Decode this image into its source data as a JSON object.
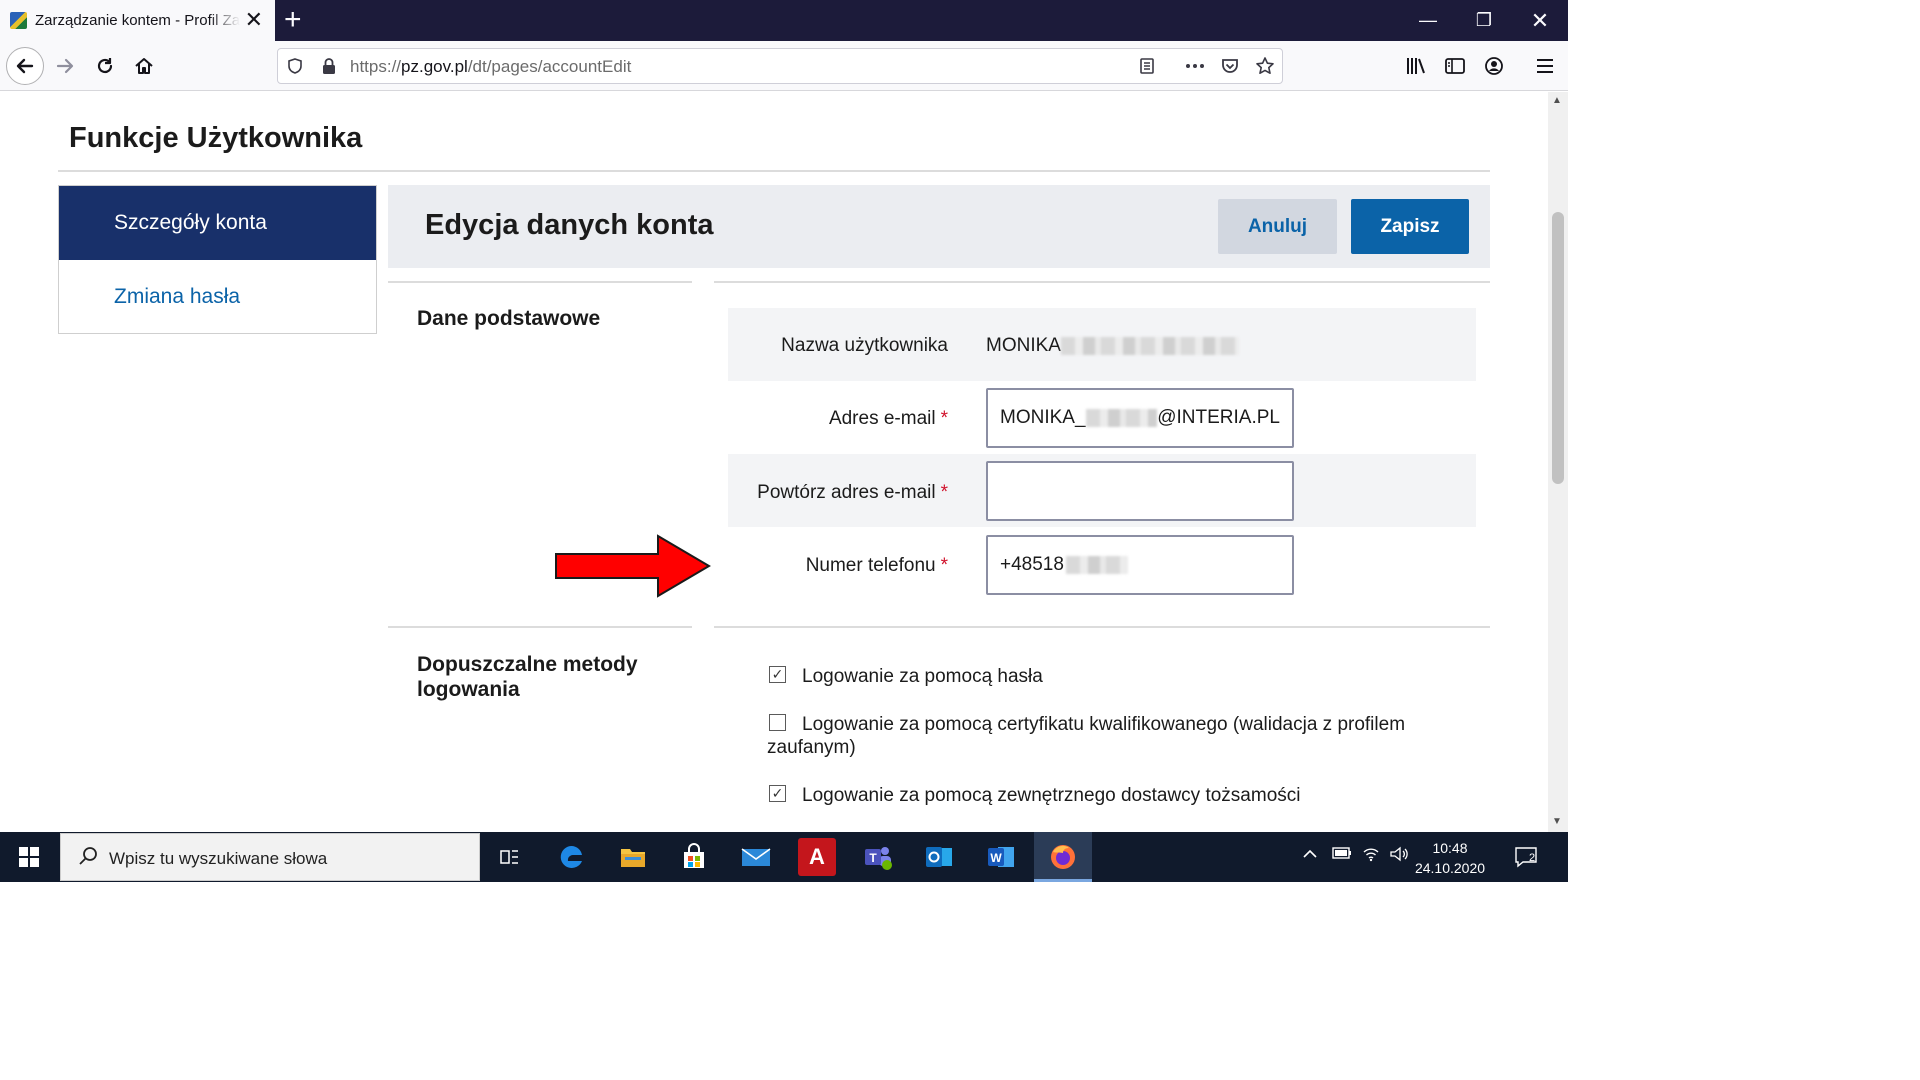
{
  "browser": {
    "tab_title": "Zarządzanie kontem - Profil Zaufany",
    "tab_close": "✕",
    "new_tab": "+",
    "url_prefix": "https://",
    "url_host": "pz.gov.pl",
    "url_path": "/dt/pages/accountEdit",
    "window_controls": {
      "minimize": "—",
      "restore": "❐",
      "close": "✕"
    },
    "icons": [
      "back-icon",
      "forward-icon",
      "reload-icon",
      "home-icon",
      "shield-icon",
      "lock-icon",
      "reader-view-icon",
      "more-icon",
      "pocket-icon",
      "bookmark-star-icon",
      "library-icon",
      "sidebar-icon",
      "account-icon",
      "menu-icon"
    ]
  },
  "page": {
    "section_title": "Funkcje Użytkownika",
    "sidebar": {
      "items": [
        {
          "label": "Szczegóły konta",
          "active": true
        },
        {
          "label": "Zmiana hasła",
          "active": false
        }
      ]
    },
    "edit": {
      "title": "Edycja danych konta",
      "cancel_label": "Anuluj",
      "save_label": "Zapisz"
    },
    "basic": {
      "title": "Dane podstawowe",
      "username_label": "Nazwa użytkownika",
      "username_value": "MONIKA",
      "email_label": "Adres e-mail",
      "email_value_start": "MONIKA_",
      "email_value_end": "@INTERIA.PL",
      "email_repeat_label": "Powtórz adres e-mail",
      "email_repeat_value": "",
      "phone_label": "Numer telefonu",
      "phone_value": "+48518",
      "required_mark": "*"
    },
    "login_methods": {
      "title": "Dopuszczalne metody logowania",
      "options": [
        {
          "label": "Logowanie za pomocą hasła",
          "checked": true
        },
        {
          "label": "Logowanie za pomocą certyfikatu kwalifikowanego (walidacja z profilem zaufanym)",
          "checked": false
        },
        {
          "label": "Logowanie za pomocą zewnętrznego dostawcy tożsamości",
          "checked": true
        }
      ]
    }
  },
  "taskbar": {
    "search_placeholder": "Wpisz tu wyszukiwane słowa",
    "time": "10:48",
    "date": "24.10.2020",
    "notification_count": "2",
    "apps": [
      "task-view-icon",
      "edge-icon",
      "file-explorer-icon",
      "store-icon",
      "mail-icon",
      "ipocc-icon",
      "teams-icon",
      "outlook-icon",
      "word-icon",
      "firefox-icon"
    ]
  },
  "colors": {
    "nav_active_bg": "#18306a",
    "link": "#0b63a8",
    "primary_button": "#0b63a8",
    "required": "#d0112b",
    "annotation_arrow": "#ff0000"
  }
}
